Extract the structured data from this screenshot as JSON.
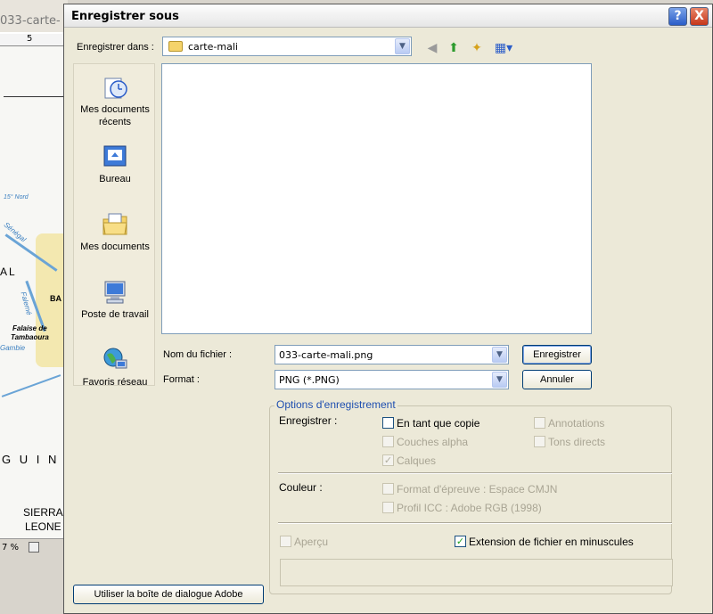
{
  "background": {
    "title": "033-carte-",
    "ruler_number": "5",
    "map_labels": {
      "north": "15° Nord",
      "senegal": "Sénégal",
      "al": "AL",
      "falaise": "Falaise de",
      "tambaoura": "Tambaoura",
      "falemé": "Falemé",
      "bafing": "BA",
      "gambie": "Gambie",
      "guinee": "G U I N É",
      "sierra": "SIERRA",
      "leone": "LEONE"
    },
    "zoom": "7 %"
  },
  "dialog": {
    "title": "Enregistrer sous",
    "help_button": "?",
    "close_button": "X",
    "save_in_label": "Enregistrer dans :",
    "save_in_value": "carte-mali",
    "places": [
      {
        "label": "Mes documents récents"
      },
      {
        "label": "Bureau"
      },
      {
        "label": "Mes documents"
      },
      {
        "label": "Poste de travail"
      },
      {
        "label": "Favoris réseau"
      }
    ],
    "filename_label": "Nom du fichier :",
    "filename_value": "033-carte-mali.png",
    "format_label": "Format :",
    "format_value": "PNG (*.PNG)",
    "save_button": "Enregistrer",
    "cancel_button": "Annuler",
    "options": {
      "legend": "Options d'enregistrement",
      "save_label": "Enregistrer :",
      "as_copy": "En tant que copie",
      "annotations": "Annotations",
      "alpha_channels": "Couches alpha",
      "spot_colors": "Tons directs",
      "layers": "Calques",
      "color_label": "Couleur :",
      "proof_format": "Format d'épreuve : Espace CMJN",
      "icc_profile": "Profil ICC : Adobe RGB (1998)",
      "preview": "Aperçu",
      "lowercase_ext": "Extension de fichier en minuscules"
    },
    "adobe_dialog_button": "Utiliser la boîte de dialogue Adobe"
  }
}
